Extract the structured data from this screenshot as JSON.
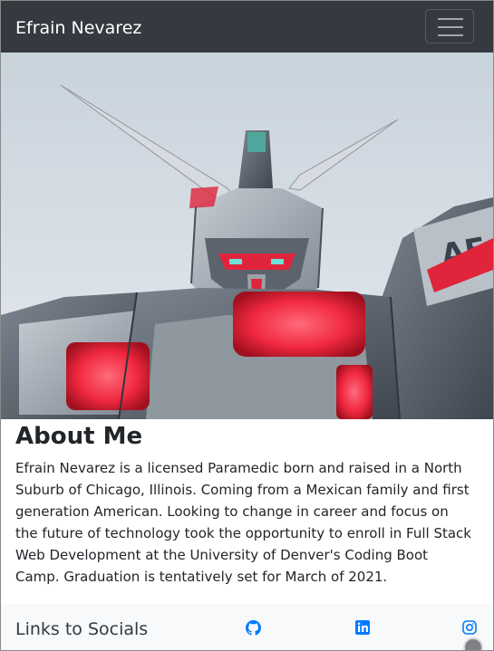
{
  "navbar": {
    "brand": "Efrain Nevarez",
    "toggler_icon": "hamburger-icon"
  },
  "hero": {
    "image": "gundam-robot-photo"
  },
  "about": {
    "title": "About Me",
    "text": "Efrain Nevarez is a licensed Paramedic born and raised in a North Suburb of Chicago, Illinois. Coming from a Mexican family and first generation American. Looking to change in career and focus on the future of technology took the opportunity to enroll in Full Stack Web Development at the University of Denver's Coding Boot Camp. Graduation is tentatively set for March of 2021."
  },
  "footer": {
    "title": "Links to Socials",
    "socials": [
      "github-icon",
      "linkedin-icon",
      "instagram-icon"
    ]
  },
  "colors": {
    "navbar_bg": "#343a40",
    "link_blue": "#007bff",
    "footer_bg": "#f8f9fa"
  }
}
